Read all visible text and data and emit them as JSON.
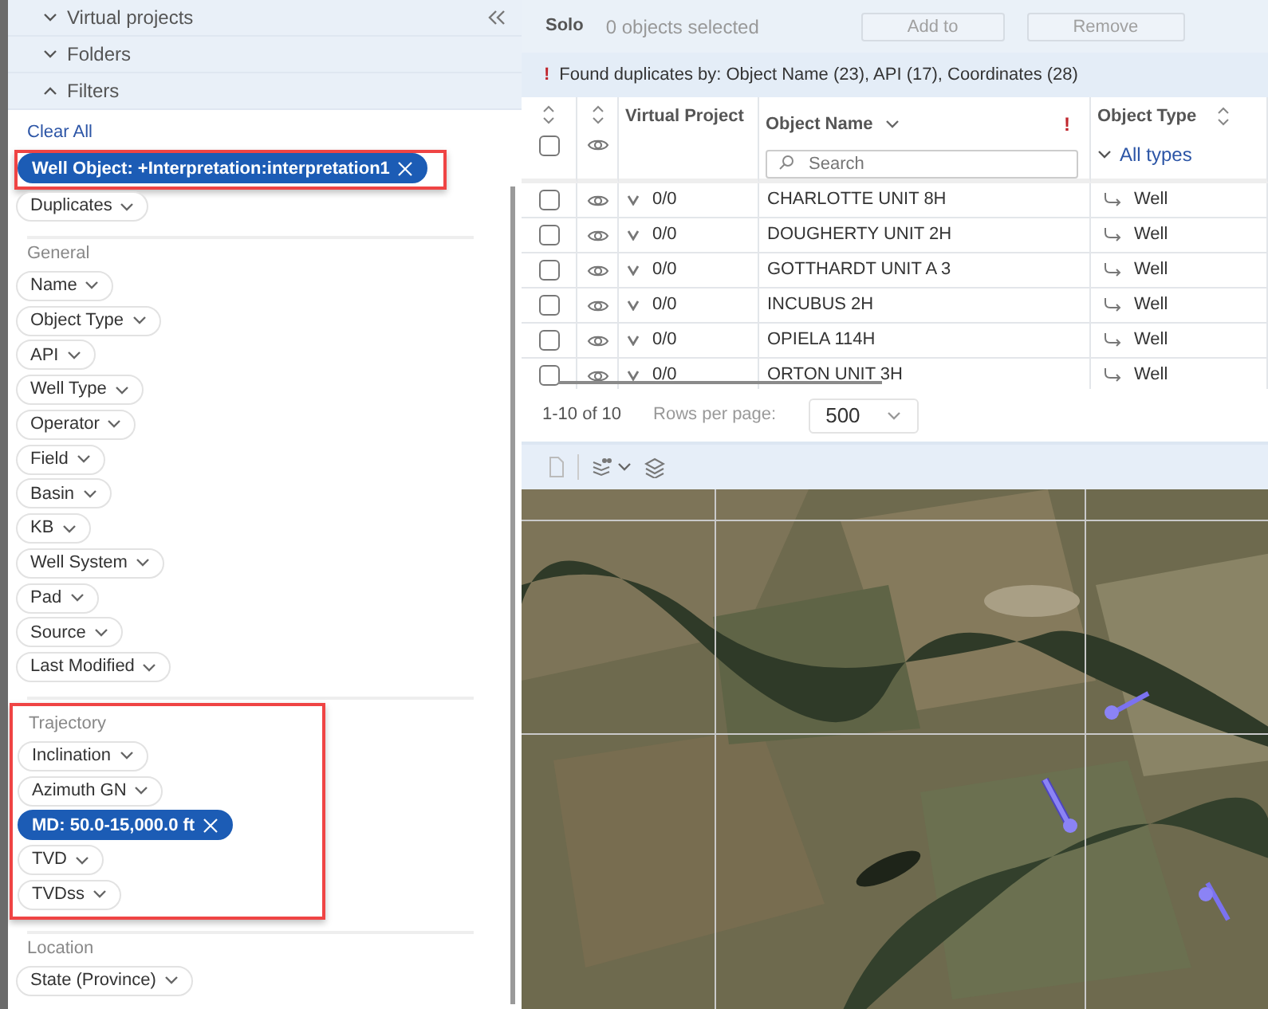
{
  "sidebar": {
    "sections": [
      {
        "label": "Virtual projects",
        "expanded": false
      },
      {
        "label": "Folders",
        "expanded": false
      },
      {
        "label": "Filters",
        "expanded": true
      }
    ],
    "clear_all": "Clear All",
    "filter_groups": [
      {
        "highlighted": true,
        "chips": [
          {
            "label": "Well Object: +Interpretation:interpretation1",
            "active": true
          }
        ]
      },
      {
        "highlighted": false,
        "chips": [
          {
            "label": "Duplicates",
            "active": false
          }
        ]
      },
      {
        "heading": "General",
        "highlighted": false,
        "chips": [
          {
            "label": "Name",
            "active": false
          },
          {
            "label": "Object Type",
            "active": false
          },
          {
            "label": "API",
            "active": false
          },
          {
            "label": "Well Type",
            "active": false
          },
          {
            "label": "Operator",
            "active": false
          },
          {
            "label": "Field",
            "active": false
          },
          {
            "label": "Basin",
            "active": false
          },
          {
            "label": "KB",
            "active": false
          },
          {
            "label": "Well System",
            "active": false
          },
          {
            "label": "Pad",
            "active": false
          },
          {
            "label": "Source",
            "active": false
          },
          {
            "label": "Last Modified",
            "active": false
          }
        ]
      },
      {
        "heading": "Trajectory",
        "highlighted": true,
        "chips": [
          {
            "label": "Inclination",
            "active": false
          },
          {
            "label": "Azimuth GN",
            "active": false
          },
          {
            "label": "MD: 50.0-15,000.0 ft",
            "active": true
          },
          {
            "label": "TVD",
            "active": false
          },
          {
            "label": "TVDss",
            "active": false
          }
        ]
      },
      {
        "heading": "Location",
        "highlighted": false,
        "chips": [
          {
            "label": "State (Province)",
            "active": false
          }
        ]
      }
    ]
  },
  "toolbar": {
    "mode": "Solo",
    "selection": "0 objects selected",
    "buttons": [
      {
        "label": "Add to",
        "disabled": true
      },
      {
        "label": "Remove",
        "disabled": true
      }
    ]
  },
  "alert": {
    "icon": "!",
    "text": "Found duplicates by: Object Name (23), API (17), Coordinates (28)"
  },
  "table": {
    "select_all": {
      "checked": false
    },
    "columns": [
      {
        "label": "Virtual Project"
      },
      {
        "label": "Object Name",
        "warning": "!",
        "placeholder": "Search"
      },
      {
        "label": "Object Type",
        "filter": "All types"
      }
    ],
    "rows": [
      {
        "checked": false,
        "virtual_project": "0/0",
        "name": "CHARLOTTE UNIT 8H",
        "type": "Well"
      },
      {
        "checked": false,
        "virtual_project": "0/0",
        "name": "DOUGHERTY UNIT 2H",
        "type": "Well"
      },
      {
        "checked": false,
        "virtual_project": "0/0",
        "name": "GOTTHARDT UNIT A 3",
        "type": "Well"
      },
      {
        "checked": false,
        "virtual_project": "0/0",
        "name": "INCUBUS 2H",
        "type": "Well"
      },
      {
        "checked": false,
        "virtual_project": "0/0",
        "name": "OPIELA 114H",
        "type": "Well"
      },
      {
        "checked": false,
        "virtual_project": "0/0",
        "name": "ORTON UNIT 3H",
        "type": "Well"
      }
    ],
    "footer": {
      "range": "1-10 of 10",
      "rows_label": "Rows per page:",
      "rows_value": "500"
    }
  }
}
